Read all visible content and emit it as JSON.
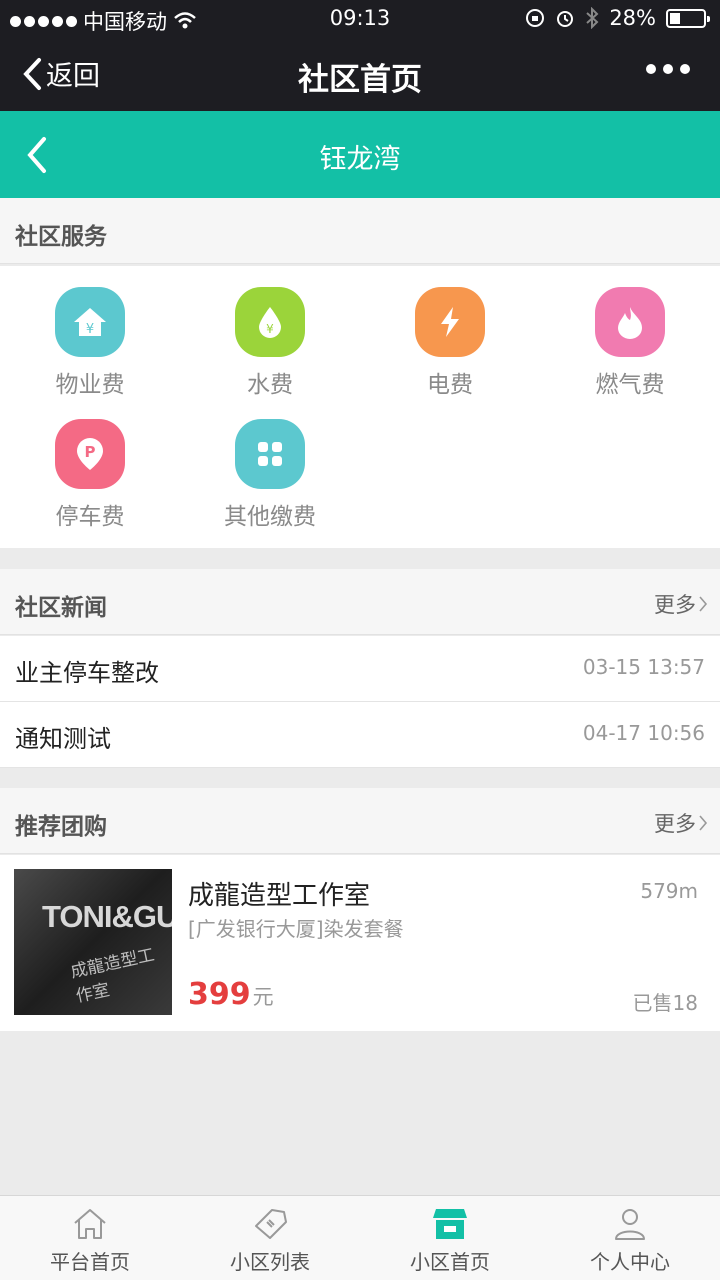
{
  "status_bar": {
    "carrier": "中国移动",
    "time": "09:13",
    "battery": "28%"
  },
  "wechat_nav": {
    "back_label": "返回",
    "title": "社区首页"
  },
  "header": {
    "title": "钰龙湾",
    "accent_color": "#13c0a6"
  },
  "services": {
    "title": "社区服务",
    "items": [
      {
        "label": "物业费",
        "icon": "house-yen-icon",
        "color": "#5cc8cf"
      },
      {
        "label": "水费",
        "icon": "water-drop-yen-icon",
        "color": "#9bd43a"
      },
      {
        "label": "电费",
        "icon": "lightning-icon",
        "color": "#f7974e"
      },
      {
        "label": "燃气费",
        "icon": "flame-icon",
        "color": "#f17bb0"
      },
      {
        "label": "停车费",
        "icon": "parking-pin-icon",
        "color": "#f46a85"
      },
      {
        "label": "其他缴费",
        "icon": "grid-icon",
        "color": "#5cc8cf"
      }
    ]
  },
  "news": {
    "title": "社区新闻",
    "more_label": "更多",
    "items": [
      {
        "title": "业主停车整改",
        "date": "03-15 13:57"
      },
      {
        "title": "通知测试",
        "date": "04-17 10:56"
      }
    ]
  },
  "group_buy": {
    "title": "推荐团购",
    "more_label": "更多",
    "deal": {
      "name": "成龍造型工作室",
      "distance": "579m",
      "description": "[广发银行大厦]染发套餐",
      "price": "399",
      "unit": "元",
      "sold": "已售18",
      "image_text_1": "TONI&GUY",
      "image_text_2": "成龍造型工作室"
    }
  },
  "tabbar": {
    "items": [
      {
        "label": "平台首页",
        "icon": "home-icon"
      },
      {
        "label": "小区列表",
        "icon": "ticket-icon"
      },
      {
        "label": "小区首页",
        "icon": "store-icon",
        "active": true
      },
      {
        "label": "个人中心",
        "icon": "user-icon"
      }
    ]
  }
}
